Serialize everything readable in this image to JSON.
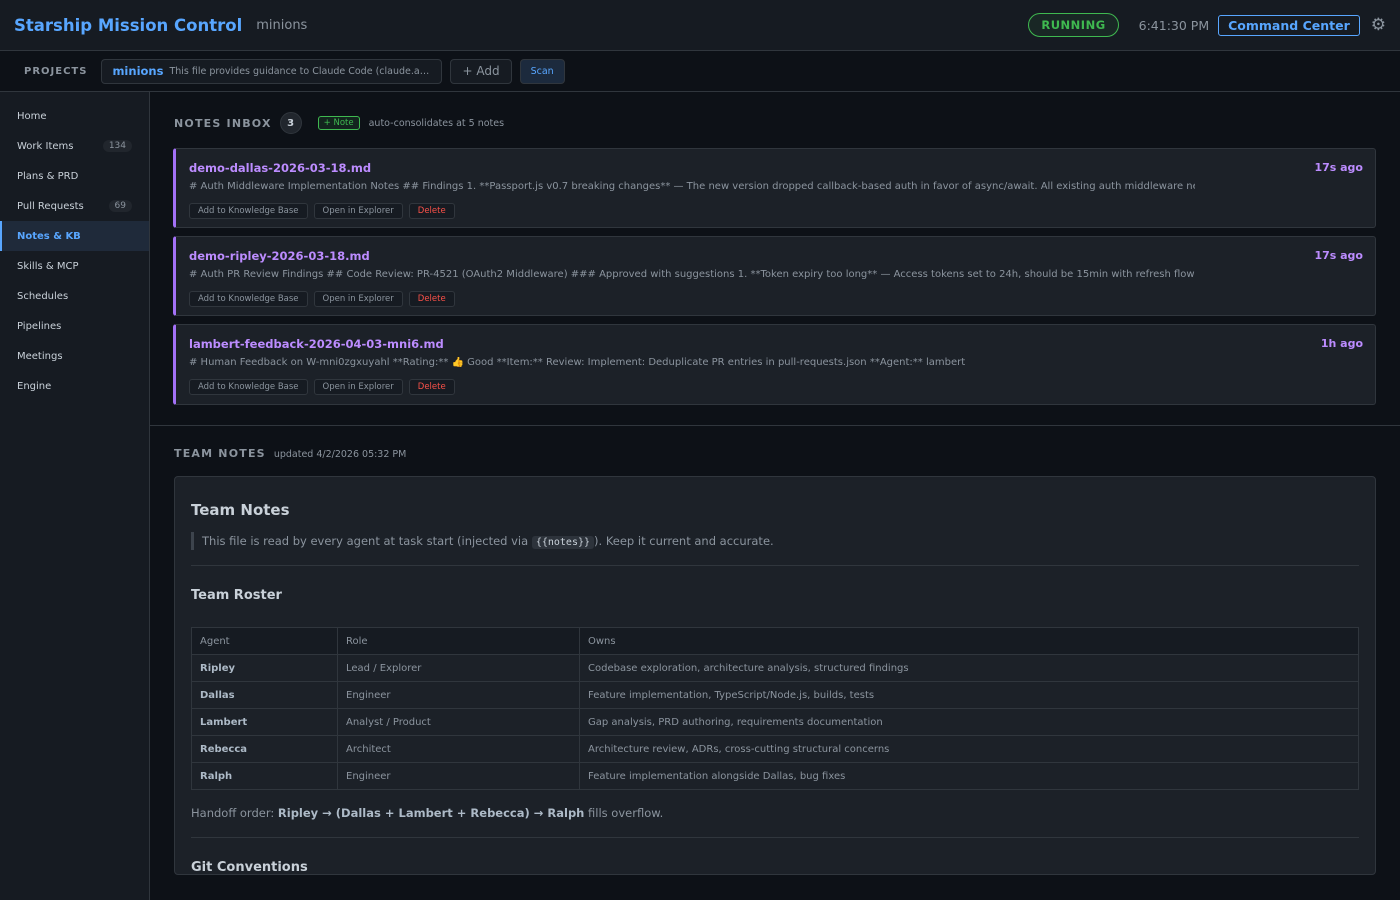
{
  "header": {
    "title": "Starship Mission Control",
    "project": "minions",
    "status": "RUNNING",
    "time": "6:41:30 PM",
    "command_center": "Command Center",
    "settings_icon": "gear-icon"
  },
  "projects": {
    "label": "PROJECTS",
    "current_name": "minions",
    "current_desc": "This file provides guidance to Claude Code (claude.ai/code) ...",
    "add_label": "+ Add",
    "scan_label": "Scan"
  },
  "sidebar": {
    "items": [
      {
        "label": "Home",
        "badge": ""
      },
      {
        "label": "Work Items",
        "badge": "134"
      },
      {
        "label": "Plans & PRD",
        "badge": ""
      },
      {
        "label": "Pull Requests",
        "badge": "69"
      },
      {
        "label": "Notes & KB",
        "badge": ""
      },
      {
        "label": "Skills & MCP",
        "badge": ""
      },
      {
        "label": "Schedules",
        "badge": ""
      },
      {
        "label": "Pipelines",
        "badge": ""
      },
      {
        "label": "Meetings",
        "badge": ""
      },
      {
        "label": "Engine",
        "badge": ""
      }
    ],
    "active": "Notes & KB"
  },
  "inbox": {
    "title": "NOTES INBOX",
    "count": "3",
    "add_note": "+ Note",
    "consolidate_text": "auto-consolidates at 5 notes",
    "notes": [
      {
        "file": "demo-dallas-2026-03-18.md",
        "time": "17s ago",
        "preview": "# Auth Middleware Implementation Notes ## Findings 1. **Passport.js v0.7 breaking changes** — The new version dropped callback-based auth in favor of async/await. All existing auth middleware needs u",
        "add_kb": "Add to Knowledge Base",
        "open": "Open in Explorer",
        "delete": "Delete"
      },
      {
        "file": "demo-ripley-2026-03-18.md",
        "time": "17s ago",
        "preview": "# Auth PR Review Findings ## Code Review: PR-4521 (OAuth2 Middleware) ### Approved with suggestions 1. **Token expiry too long** — Access tokens set to 24h, should be 15min with refresh flow (sourc",
        "add_kb": "Add to Knowledge Base",
        "open": "Open in Explorer",
        "delete": "Delete"
      },
      {
        "file": "lambert-feedback-2026-04-03-mni6.md",
        "time": "1h ago",
        "preview": "# Human Feedback on W-mni0zgxuyahl **Rating:** 👍 Good **Item:** Review: Implement: Deduplicate PR entries in pull-requests.json **Agent:** lambert",
        "add_kb": "Add to Knowledge Base",
        "open": "Open in Explorer",
        "delete": "Delete"
      }
    ]
  },
  "team_notes": {
    "title": "TEAM NOTES",
    "updated": "updated 4/2/2026 05:32 PM",
    "h1": "Team Notes",
    "intro_before": "This file is read by every agent at task start (injected via ",
    "intro_code": "{{notes}}",
    "intro_after": "). Keep it current and accurate.",
    "roster_heading": "Team Roster",
    "columns": [
      "Agent",
      "Role",
      "Owns"
    ],
    "rows": [
      [
        "Ripley",
        "Lead / Explorer",
        "Codebase exploration, architecture analysis, structured findings"
      ],
      [
        "Dallas",
        "Engineer",
        "Feature implementation, TypeScript/Node.js, builds, tests"
      ],
      [
        "Lambert",
        "Analyst / Product",
        "Gap analysis, PRD authoring, requirements documentation"
      ],
      [
        "Rebecca",
        "Architect",
        "Architecture review, ADRs, cross-cutting structural concerns"
      ],
      [
        "Ralph",
        "Engineer",
        "Feature implementation alongside Dallas, bug fixes"
      ]
    ],
    "handoff_prefix": "Handoff order: ",
    "handoff_bold": "Ripley → (Dallas + Lambert + Rebecca) → Ralph",
    "handoff_suffix": " fills overflow.",
    "git_heading": "Git Conventions"
  }
}
